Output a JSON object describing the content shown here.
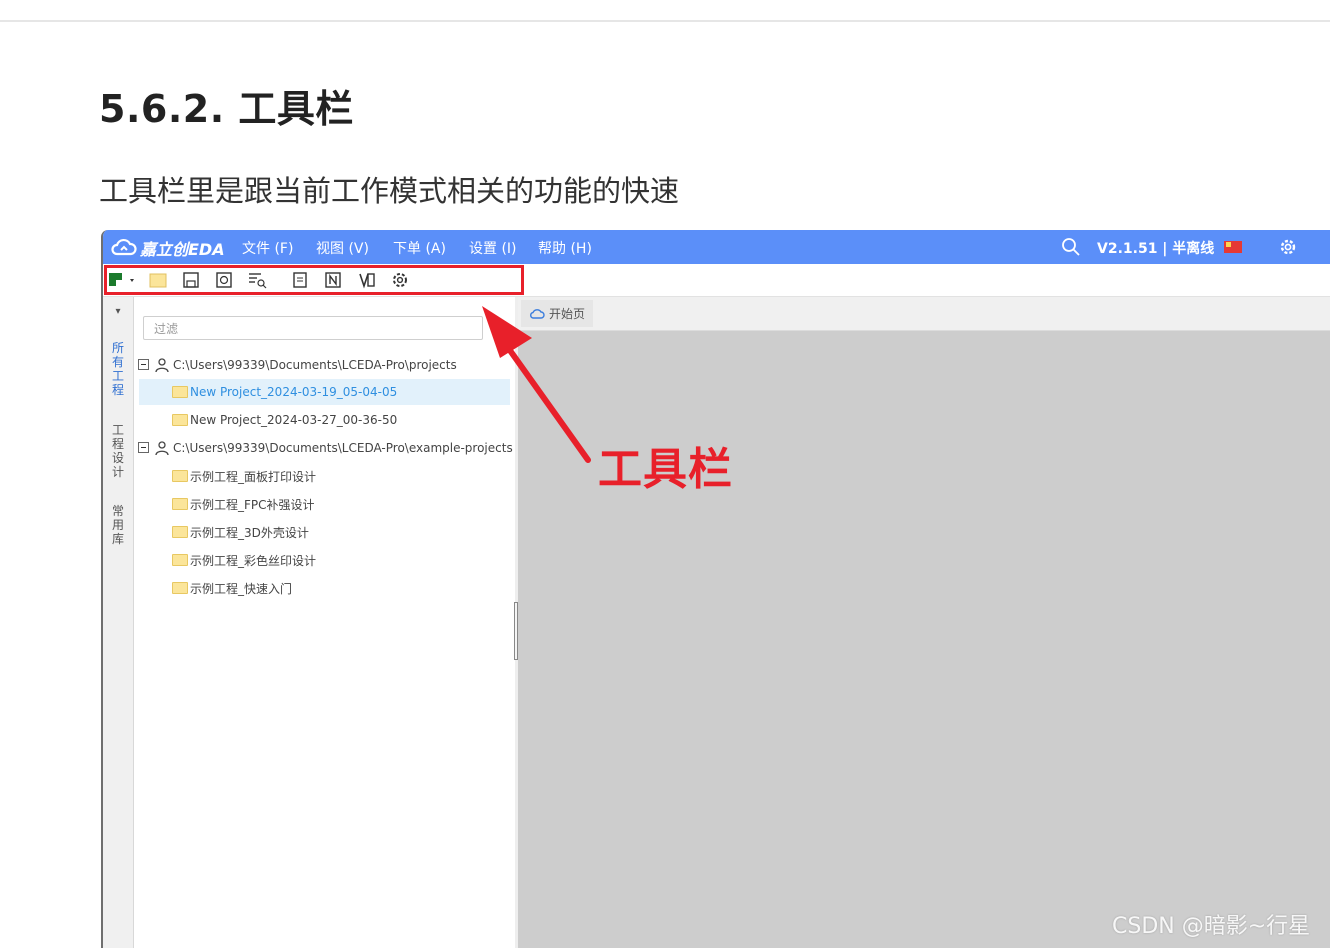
{
  "article": {
    "heading": "5.6.2. 工具栏",
    "paragraph": "工具栏里是跟当前工作模式相关的功能的快速"
  },
  "app": {
    "logo_text": "嘉立创EDA",
    "menu": [
      "文件 (F)",
      "视图 (V)",
      "下单 (A)",
      "设置 (I)",
      "帮助 (H)"
    ],
    "version": "V2.1.51 | 半离线",
    "colors": {
      "menubar": "#5b8ff9",
      "highlight": "#e8202a",
      "selected_row": "#e2f1fb",
      "workspace": "#cdcdcd"
    }
  },
  "toolbar": {
    "icons": [
      "new-file-icon",
      "open-folder-icon",
      "save-icon",
      "save-as-icon",
      "find-icon",
      "import-icon",
      "netlist-icon",
      "bom-icon",
      "settings-icon"
    ]
  },
  "sidebar": {
    "vertical_tabs": [
      "所有工程",
      "工程设计",
      "常用库"
    ],
    "filter_placeholder": "过滤",
    "tree": [
      {
        "type": "root",
        "label": "C:\\Users\\99339\\Documents\\LCEDA-Pro\\projects"
      },
      {
        "type": "project",
        "label": "New Project_2024-03-19_05-04-05",
        "selected": true
      },
      {
        "type": "project",
        "label": "New Project_2024-03-27_00-36-50"
      },
      {
        "type": "root",
        "label": "C:\\Users\\99339\\Documents\\LCEDA-Pro\\example-projects"
      },
      {
        "type": "project",
        "label": "示例工程_面板打印设计"
      },
      {
        "type": "project",
        "label": "示例工程_FPC补强设计"
      },
      {
        "type": "project",
        "label": "示例工程_3D外壳设计"
      },
      {
        "type": "project",
        "label": "示例工程_彩色丝印设计"
      },
      {
        "type": "project",
        "label": "示例工程_快速入门"
      }
    ]
  },
  "workspace": {
    "start_tab": "开始页"
  },
  "annotation": {
    "label": "工具栏"
  },
  "watermark": "CSDN @暗影~行星"
}
